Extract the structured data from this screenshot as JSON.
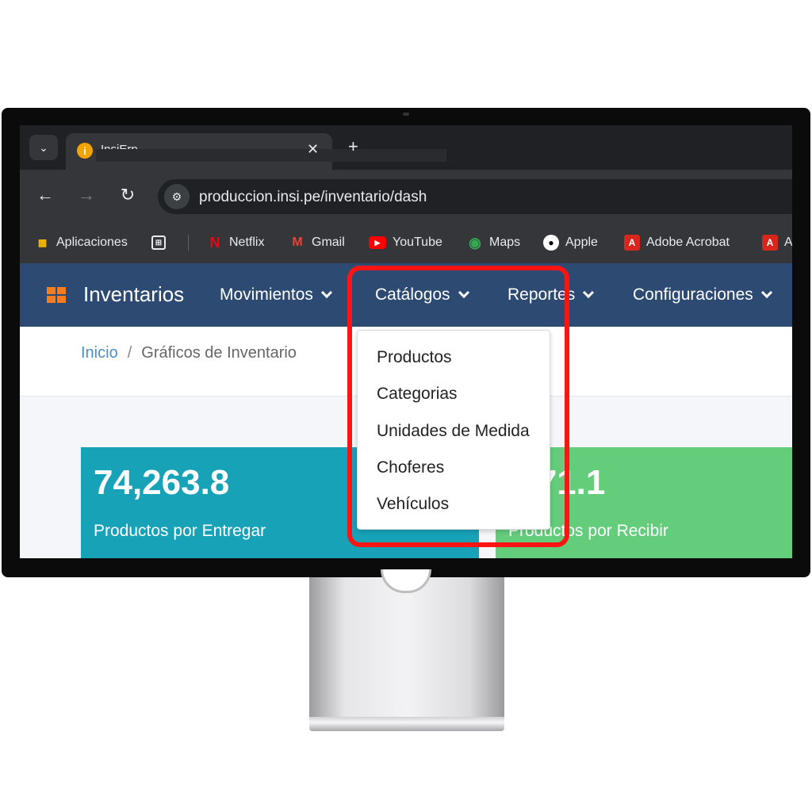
{
  "browser": {
    "tab_title": "InsiErp",
    "tab_close": "✕",
    "new_tab": "+",
    "url": "produccion.insi.pe/inventario/dash",
    "bookmarks": [
      {
        "label": "Aplicaciones",
        "icon": "apps-grid-icon"
      },
      {
        "label": "",
        "icon": "tab-groups-icon"
      },
      {
        "label": "Netflix",
        "icon": "netflix-icon",
        "color": "#e50914"
      },
      {
        "label": "Gmail",
        "icon": "gmail-icon",
        "color": "#ea4335"
      },
      {
        "label": "YouTube",
        "icon": "youtube-icon",
        "color": "#ff0000"
      },
      {
        "label": "Maps",
        "icon": "maps-icon",
        "color": "#34a853"
      },
      {
        "label": "Apple",
        "icon": "apple-icon"
      },
      {
        "label": "Adobe Acrobat",
        "icon": "acrobat-icon",
        "color": "#d9261c"
      },
      {
        "label": "A",
        "icon": "acrobat-icon",
        "color": "#d9261c"
      }
    ]
  },
  "app": {
    "brand": "Inventarios",
    "menu": [
      "Movimientos",
      "Catálogos",
      "Reportes",
      "Configuraciones"
    ],
    "accent": "#2c4a72"
  },
  "breadcrumb": {
    "home": "Inicio",
    "separator": "/",
    "current": "Gráficos de Inventario"
  },
  "dropdown": {
    "items": [
      "Productos",
      "Categorias",
      "Unidades de Medida",
      "Choferes",
      "Vehículos"
    ]
  },
  "cards": [
    {
      "value": "74,263.8",
      "label": "Productos por Entregar",
      "color": "#17a2b8"
    },
    {
      "value": ",771.1",
      "label": "Productos por Recibir",
      "color": "#63cd7b"
    }
  ]
}
